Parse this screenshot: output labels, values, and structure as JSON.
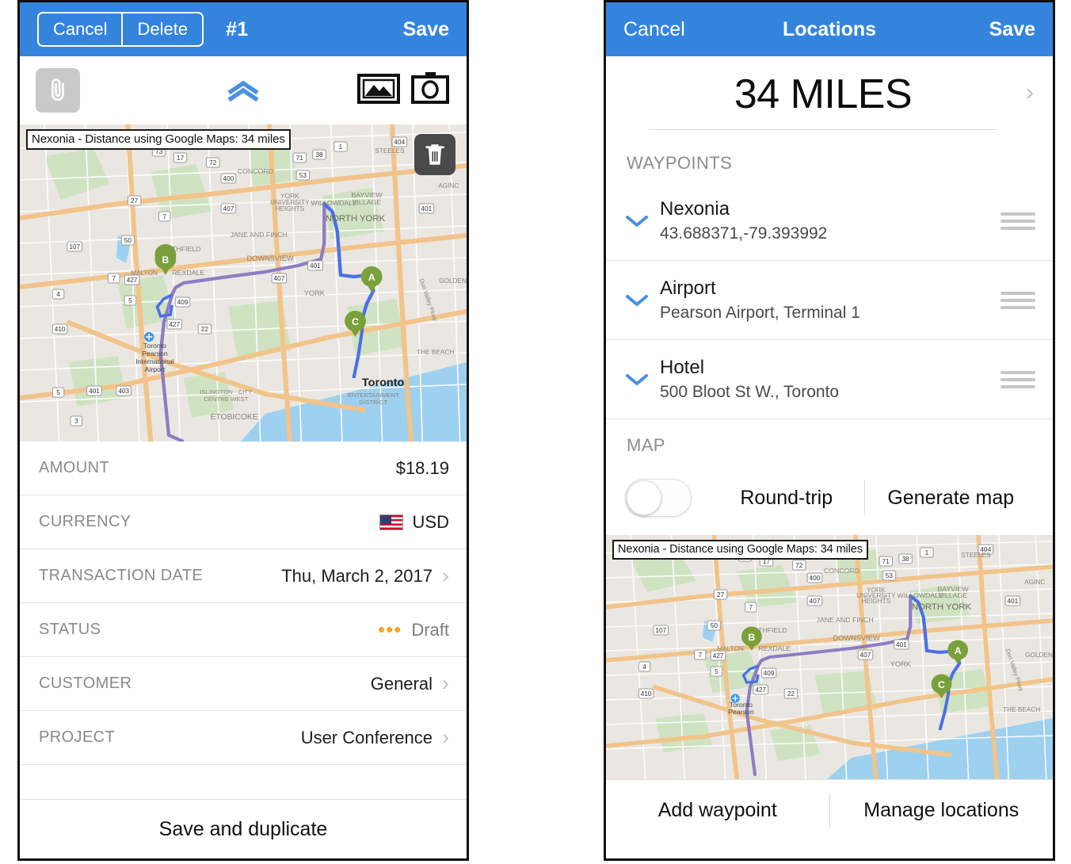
{
  "left_screen": {
    "navbar": {
      "cancel_label": "Cancel",
      "delete_label": "Delete",
      "title": "#1",
      "save_label": "Save"
    },
    "attachment_bar": {
      "clip_icon": "paperclip-icon",
      "expand_icon": "double-chevron-up-icon",
      "gallery_icon": "photo-library-icon",
      "camera_icon": "camera-icon"
    },
    "map": {
      "label": "Nexonia - Distance using Google Maps: 34 miles",
      "delete_icon": "trash-icon",
      "markers": [
        "B",
        "A",
        "C"
      ],
      "place_labels": [
        "CONCORD",
        "NORTH YORK",
        "BAYVIEW VILLAGE",
        "WILLOWDALE",
        "YORK UNIVERSITY HEIGHTS",
        "JANE AND FINCH",
        "DOWNSVIEW",
        "SMITHFIELD",
        "REXDALE",
        "MALTON",
        "YORK",
        "GOLDEN",
        "STEELES",
        "AGINC",
        "THE BEACH",
        "Toronto",
        "Toronto Pearson International Airport",
        "ISLINGTON - CITY CENTRE WEST",
        "ETOBICOKE",
        "ENTERTAINMENT DISTRICT",
        "Don Valley Pkwy"
      ],
      "route_shields": [
        "404",
        "401",
        "400",
        "407",
        "409",
        "427",
        "410",
        "403",
        "22",
        "27",
        "50",
        "7",
        "17",
        "71",
        "72",
        "73",
        "38",
        "53",
        "1",
        "107",
        "4",
        "5",
        "3"
      ]
    },
    "rows": [
      {
        "label": "AMOUNT",
        "value": "$18.19",
        "chevron": false,
        "icon": null
      },
      {
        "label": "CURRENCY",
        "value": "USD",
        "chevron": false,
        "icon": "us-flag-icon"
      },
      {
        "label": "TRANSACTION DATE",
        "value": "Thu, March 2, 2017",
        "chevron": true,
        "icon": null
      },
      {
        "label": "STATUS",
        "value": "Draft",
        "chevron": false,
        "icon": "draft-dots-icon"
      },
      {
        "label": "CUSTOMER",
        "value": "General",
        "chevron": true,
        "icon": null
      },
      {
        "label": "PROJECT",
        "value": "User Conference",
        "chevron": true,
        "icon": null
      }
    ],
    "footer": {
      "save_duplicate_label": "Save and duplicate"
    }
  },
  "right_screen": {
    "navbar": {
      "cancel_label": "Cancel",
      "title": "Locations",
      "save_label": "Save"
    },
    "distance": {
      "value": "34 MILES",
      "chevron_icon": "chevron-right-icon"
    },
    "waypoints_header": "WAYPOINTS",
    "waypoints": [
      {
        "title": "Nexonia",
        "subtitle": "43.688371,-79.393992",
        "chevron_icon": "chevron-down-icon",
        "grip_icon": "drag-handle-icon"
      },
      {
        "title": "Airport",
        "subtitle": "Pearson Airport, Terminal 1",
        "chevron_icon": "chevron-down-icon",
        "grip_icon": "drag-handle-icon"
      },
      {
        "title": "Hotel",
        "subtitle": "500 Bloot St W., Toronto",
        "chevron_icon": "chevron-down-icon",
        "grip_icon": "drag-handle-icon"
      }
    ],
    "map_header": "MAP",
    "round_trip": {
      "label": "Round-trip",
      "enabled": false
    },
    "generate_map_label": "Generate map",
    "map": {
      "label": "Nexonia - Distance using Google Maps: 34 miles",
      "markers": [
        "B",
        "A",
        "C"
      ]
    },
    "bottom_bar": {
      "add_waypoint_label": "Add waypoint",
      "manage_locations_label": "Manage locations"
    }
  },
  "colors": {
    "nav_blue": "#3484de",
    "accent_blue": "#4a90e2",
    "status_orange": "#f5a623",
    "marker_green": "#7aa03c",
    "route_purple": "#8e7cc3",
    "route_blue": "#4a6fe8"
  }
}
